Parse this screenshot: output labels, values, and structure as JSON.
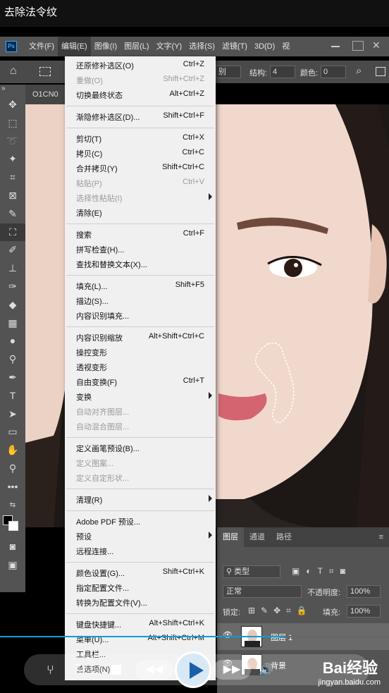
{
  "video_title": "去除法令纹",
  "menubar": {
    "items": [
      "文件(F)",
      "编辑(E)",
      "图像(I)",
      "图层(L)",
      "文字(Y)",
      "选择(S)",
      "滤镜(T)",
      "3D(D)",
      "视"
    ]
  },
  "options_bar": {
    "type_select": "别",
    "structure_label": "结构:",
    "structure_value": "4",
    "color_label": "颜色:",
    "color_value": "0"
  },
  "doc_tab": "O1CN0",
  "edit_menu": [
    {
      "label": "还原修补选区(O)",
      "shortcut": "Ctrl+Z",
      "enabled": true
    },
    {
      "label": "重做(O)",
      "shortcut": "Shift+Ctrl+Z",
      "enabled": false
    },
    {
      "label": "切换最终状态",
      "shortcut": "Alt+Ctrl+Z",
      "enabled": true
    },
    {
      "sep": true
    },
    {
      "label": "渐隐修补选区(D)...",
      "shortcut": "Shift+Ctrl+F",
      "enabled": true
    },
    {
      "sep": true
    },
    {
      "label": "剪切(T)",
      "shortcut": "Ctrl+X",
      "enabled": true
    },
    {
      "label": "拷贝(C)",
      "shortcut": "Ctrl+C",
      "enabled": true
    },
    {
      "label": "合并拷贝(Y)",
      "shortcut": "Shift+Ctrl+C",
      "enabled": true
    },
    {
      "label": "粘贴(P)",
      "shortcut": "Ctrl+V",
      "enabled": false
    },
    {
      "label": "选择性粘贴(I)",
      "shortcut": "",
      "enabled": false,
      "submenu": true
    },
    {
      "label": "清除(E)",
      "shortcut": "",
      "enabled": true
    },
    {
      "sep": true
    },
    {
      "label": "搜索",
      "shortcut": "Ctrl+F",
      "enabled": true
    },
    {
      "label": "拼写检查(H)...",
      "shortcut": "",
      "enabled": true
    },
    {
      "label": "查找和替换文本(X)...",
      "shortcut": "",
      "enabled": true
    },
    {
      "sep": true
    },
    {
      "label": "填充(L)...",
      "shortcut": "Shift+F5",
      "enabled": true
    },
    {
      "label": "描边(S)...",
      "shortcut": "",
      "enabled": true
    },
    {
      "label": "内容识别填充...",
      "shortcut": "",
      "enabled": true
    },
    {
      "sep": true
    },
    {
      "label": "内容识别缩放",
      "shortcut": "Alt+Shift+Ctrl+C",
      "enabled": true
    },
    {
      "label": "操控变形",
      "shortcut": "",
      "enabled": true
    },
    {
      "label": "透视变形",
      "shortcut": "",
      "enabled": true
    },
    {
      "label": "自由变换(F)",
      "shortcut": "Ctrl+T",
      "enabled": true
    },
    {
      "label": "变换",
      "shortcut": "",
      "enabled": true,
      "submenu": true
    },
    {
      "label": "自动对齐图层...",
      "shortcut": "",
      "enabled": false
    },
    {
      "label": "自动混合图层...",
      "shortcut": "",
      "enabled": false
    },
    {
      "sep": true
    },
    {
      "label": "定义画笔预设(B)...",
      "shortcut": "",
      "enabled": true
    },
    {
      "label": "定义图案...",
      "shortcut": "",
      "enabled": false
    },
    {
      "label": "定义自定形状...",
      "shortcut": "",
      "enabled": false
    },
    {
      "sep": true
    },
    {
      "label": "清理(R)",
      "shortcut": "",
      "enabled": true,
      "submenu": true
    },
    {
      "sep": true
    },
    {
      "label": "Adobe PDF 预设...",
      "shortcut": "",
      "enabled": true
    },
    {
      "label": "预设",
      "shortcut": "",
      "enabled": true,
      "submenu": true
    },
    {
      "label": "远程连接...",
      "shortcut": "",
      "enabled": true
    },
    {
      "sep": true
    },
    {
      "label": "颜色设置(G)...",
      "shortcut": "Shift+Ctrl+K",
      "enabled": true
    },
    {
      "label": "指定配置文件...",
      "shortcut": "",
      "enabled": true
    },
    {
      "label": "转换为配置文件(V)...",
      "shortcut": "",
      "enabled": true
    },
    {
      "sep": true
    },
    {
      "label": "键盘快捷键...",
      "shortcut": "Alt+Shift+Ctrl+K",
      "enabled": true
    },
    {
      "label": "菜单(U)...",
      "shortcut": "Alt+Shift+Ctrl+M",
      "enabled": true
    },
    {
      "label": "工具栏...",
      "shortcut": "",
      "enabled": true
    },
    {
      "label": "首选项(N)",
      "shortcut": "",
      "enabled": true
    }
  ],
  "layers_panel": {
    "tabs": [
      "图层",
      "通道",
      "路径"
    ],
    "filter": "类型",
    "blend_mode": "正常",
    "opacity_label": "不透明度:",
    "opacity_value": "100%",
    "lock_label": "锁定:",
    "fill_label": "填充:",
    "fill_value": "100%",
    "layers": [
      {
        "name": "图层 1",
        "selected": true
      },
      {
        "name": "背景",
        "selected": false
      }
    ]
  },
  "player": {
    "progress": 0.73
  },
  "watermark": {
    "brand": "Bai经验",
    "url": "jingyan.baidu.com"
  },
  "colors": {
    "accent": "#00a1d6",
    "ps_blue": "#31a8ff"
  }
}
